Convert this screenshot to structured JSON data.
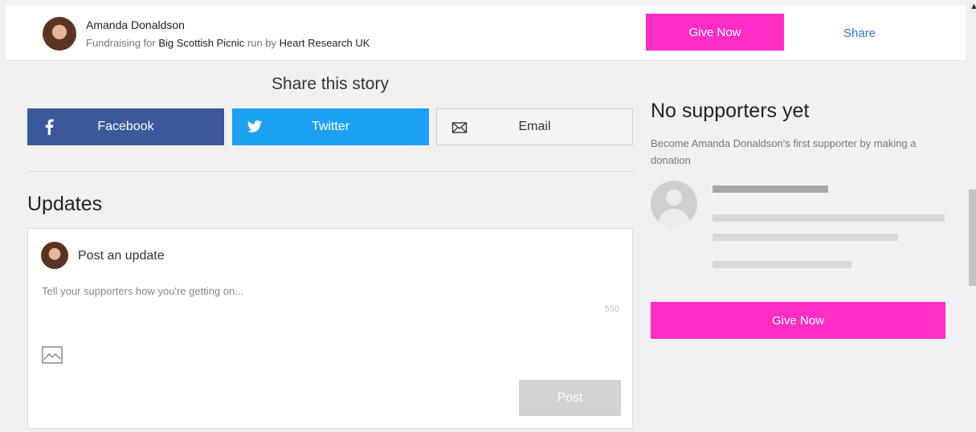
{
  "header": {
    "fundraiser_name": "Amanda Donaldson",
    "subtitle_prefix": "Fundraising for",
    "event_name": "Big Scottish Picnic",
    "subtitle_middle": "run by",
    "charity_name": "Heart Research UK",
    "give_now_label": "Give Now",
    "share_label": "Share"
  },
  "share": {
    "title": "Share this story",
    "facebook_label": "Facebook",
    "twitter_label": "Twitter",
    "email_label": "Email"
  },
  "updates": {
    "title": "Updates",
    "post_heading": "Post an update",
    "placeholder": "Tell your supporters how you're getting on...",
    "char_count": "550",
    "post_button_label": "Post"
  },
  "supporters": {
    "title": "No supporters yet",
    "description": "Become Amanda Donaldson's first supporter by making a donation",
    "give_now_label": "Give Now"
  },
  "colors": {
    "accent_pink": "#ff2dc4",
    "facebook_blue": "#3b5998",
    "twitter_blue": "#1da1f2",
    "link_blue": "#2a78c8"
  },
  "icons": [
    "facebook-icon",
    "twitter-icon",
    "email-icon",
    "image-icon",
    "avatar-placeholder-icon"
  ]
}
